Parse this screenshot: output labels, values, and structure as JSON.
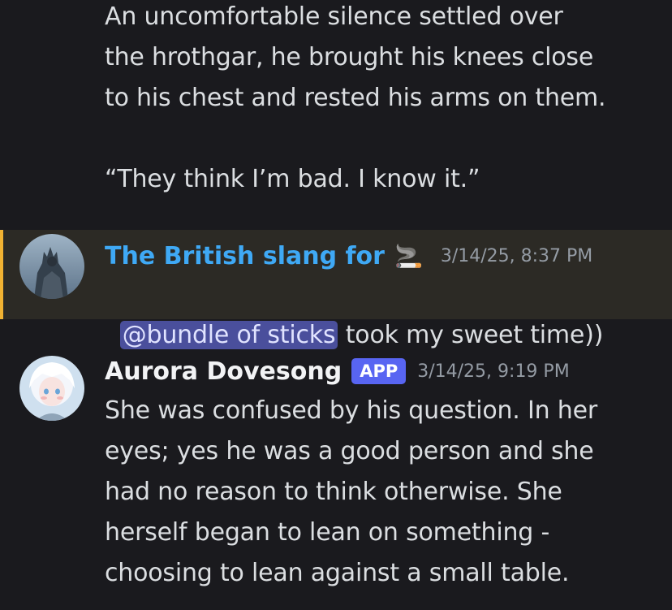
{
  "continuation": {
    "lines": [
      "An uncomfortable silence settled over",
      "the hrothgar, he brought his knees close",
      "to his chest and rested his arms on them.",
      "",
      "“They think I’m bad. I know it.”"
    ]
  },
  "reply": {
    "username": "The British slang for",
    "username_emoji": "🚬",
    "username_color": "#3fa9f5",
    "timestamp": "3/14/25, 8:37 PM",
    "mention": "@bundle of sticks",
    "text": " took my sweet time))",
    "highlight_color": "#f0b232"
  },
  "message": {
    "username": "Aurora Dovesong",
    "badge": "APP",
    "timestamp": "3/14/25, 9:19 PM",
    "lines": [
      "She was confused by his question. In her",
      "eyes; yes he was a good person and she",
      "had no reason to think otherwise. She",
      "herself began to lean on something -",
      "choosing to lean against a small table."
    ]
  }
}
